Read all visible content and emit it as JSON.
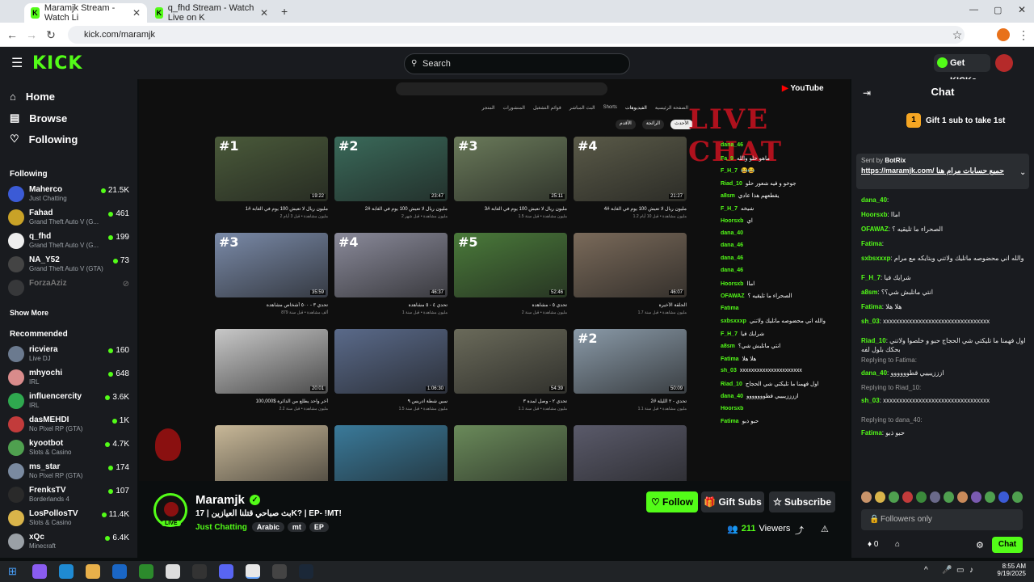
{
  "browser": {
    "tabs": [
      {
        "title": "Maramjk Stream - Watch Li",
        "active": true
      },
      {
        "title": "q_fhd Stream - Watch Live on K",
        "active": false
      }
    ],
    "url": "kick.com/maramjk"
  },
  "header": {
    "logo": "KICK",
    "search_placeholder": "Search",
    "get_kicks": "Get KICKs"
  },
  "sidebar": {
    "nav": [
      {
        "label": "Home",
        "icon": "home-icon"
      },
      {
        "label": "Browse",
        "icon": "browse-icon"
      },
      {
        "label": "Following",
        "icon": "heart-icon"
      }
    ],
    "following_title": "Following",
    "following": [
      {
        "name": "Maherco",
        "category": "Just Chatting",
        "viewers": "21.5K",
        "color": "#3b5bd6"
      },
      {
        "name": "Fahad",
        "category": "Grand Theft Auto V (G...",
        "viewers": "461",
        "color": "#c9a227"
      },
      {
        "name": "q_fhd",
        "category": "Grand Theft Auto V (G...",
        "viewers": "199",
        "color": "#eeeeee"
      },
      {
        "name": "NA_Y52",
        "category": "Grand Theft Auto V (GTA)",
        "viewers": "73",
        "color": "#444"
      },
      {
        "name": "ForzaAziz",
        "category": "",
        "viewers": "",
        "color": "#555",
        "offline": true
      }
    ],
    "show_more": "Show More",
    "recommended_title": "Recommended",
    "recommended": [
      {
        "name": "ricviera",
        "category": "Live DJ",
        "viewers": "160",
        "color": "#6b7a8f"
      },
      {
        "name": "mhyochi",
        "category": "IRL",
        "viewers": "648",
        "color": "#d98b8b"
      },
      {
        "name": "influencercity",
        "category": "IRL",
        "viewers": "3.6K",
        "color": "#2fa84f"
      },
      {
        "name": "dasMEHDI",
        "category": "No Pixel RP (GTA)",
        "viewers": "1K",
        "color": "#c23b3b"
      },
      {
        "name": "kyootbot",
        "category": "Slots & Casino",
        "viewers": "4.7K",
        "color": "#4fa04f"
      },
      {
        "name": "ms_star",
        "category": "No Pixel RP (GTA)",
        "viewers": "174",
        "color": "#7a8aa0"
      },
      {
        "name": "FrenksTV",
        "category": "Borderlands 4",
        "viewers": "107",
        "color": "#2a2a2a"
      },
      {
        "name": "LosPollosTV",
        "category": "Slots & Casino",
        "viewers": "11.4K",
        "color": "#d9b44a"
      },
      {
        "name": "xQc",
        "category": "Minecraft",
        "viewers": "6.4K",
        "color": "#9aa0a6"
      }
    ]
  },
  "youtube": {
    "logo": "YouTube",
    "tabs": [
      "الصفحة الرئيسية",
      "الفيديوهات",
      "Shorts",
      "البث المباشر",
      "قوائم التشغيل",
      "المنشورات",
      "المتجر"
    ],
    "filters": [
      "الأحدث",
      "الرائجة",
      "الأقدم"
    ],
    "videos": [
      {
        "num": "#1",
        "duration": "19:22",
        "title": "مليون ريال لا تعيش 100 يوم في الغابة #1",
        "meta": "2 مليون مشاهدة • قبل 3 أيام",
        "color": "#4a5a3a"
      },
      {
        "num": "#2",
        "duration": "23:47",
        "title": "مليون ريال لا تعيش 100 يوم في الغابة #2",
        "meta": "2 مليون مشاهدة • قبل شهر",
        "color": "#3a6a5a"
      },
      {
        "num": "#3",
        "duration": "25:11",
        "title": "مليون ريال لا تعيش 100 يوم في الغابة #3",
        "meta": "1.5 مليون مشاهدة • قبل سنة",
        "color": "#6a7a5a"
      },
      {
        "num": "#4",
        "duration": "21:27",
        "title": "مليون ريال لا تعيش 100 يوم في الغابة #4",
        "meta": "1.2 مليون مشاهدة • قبل 10 أيام",
        "color": "#5a5a48"
      },
      {
        "num": "#3",
        "duration": "35:59",
        "title": "تحدي ٣ - ٥٠٠ أشخاص مشاهدة",
        "meta": "879 ألف مشاهدة • قبل سنة",
        "color": "#7a8aa8"
      },
      {
        "num": "#4",
        "duration": "46:37",
        "title": "تحدي ٤ - ٥ مشاهدة",
        "meta": "1 مليون مشاهدة • قبل سنة",
        "color": "#8a8a9a"
      },
      {
        "num": "#5",
        "duration": "52:46",
        "title": "تحدي ٥ - مشاهدة",
        "meta": "2 مليون مشاهدة • قبل سنة",
        "color": "#4a7a3a"
      },
      {
        "num": "",
        "duration": "46:07",
        "title": "الحلقة الأخيرة",
        "meta": "1.7 مليون مشاهدة • قبل سنة",
        "color": "#7a6a5a"
      },
      {
        "num": "",
        "duration": "20:01",
        "title": "أخر واحد يطلع من الدائرة $100,000",
        "meta": "2.2 مليون مشاهدة • قبل سنة",
        "color": "#c8c8c8"
      },
      {
        "num": "",
        "duration": "1:06:30",
        "title": "سين شطة ادريس ٩",
        "meta": "1.5 مليون مشاهدة • قبل سنة",
        "color": "#5a6a8a"
      },
      {
        "num": "",
        "duration": "54:39",
        "title": "تحدي ٢ - وصل لمدة ٣",
        "meta": "1.1 مليون مشاهدة • قبل سنة",
        "color": "#6a6a5a"
      },
      {
        "num": "#2",
        "duration": "50:09",
        "title": "تحدي - ٢ الليلة #2",
        "meta": "1.1 مليون مشاهدة • قبل سنة",
        "color": "#8a9aa8"
      },
      {
        "num": "",
        "duration": "",
        "title": "",
        "meta": "",
        "color": "#c8b898"
      },
      {
        "num": "",
        "duration": "",
        "title": "",
        "meta": "",
        "color": "#3a7a9a"
      },
      {
        "num": "",
        "duration": "",
        "title": "",
        "meta": "",
        "color": "#6a8a5a"
      },
      {
        "num": "",
        "duration": "",
        "title": "",
        "meta": "",
        "color": "#5a5a6a"
      }
    ],
    "live_chat_title": "LIVE CHAT",
    "live_chat": [
      {
        "user": "dana_46",
        "msg": ""
      },
      {
        "user": "Fa_9",
        "msg": "ماهو حلو والله"
      },
      {
        "user": "F_H_7",
        "msg": "😂😂"
      },
      {
        "user": "Riad_10",
        "msg": "جوخو و فيه شعور حلو"
      },
      {
        "user": "a8sm",
        "msg": "يقطعهم هذا عادي"
      },
      {
        "user": "F_H_7",
        "msg": "شيخه"
      },
      {
        "user": "Hoorsxb",
        "msg": "اي"
      },
      {
        "user": "dana_40",
        "msg": ""
      },
      {
        "user": "dana_46",
        "msg": ""
      },
      {
        "user": "dana_46",
        "msg": ""
      },
      {
        "user": "dana_46",
        "msg": ""
      },
      {
        "user": "Hoorsxb",
        "msg": "اماا"
      },
      {
        "user": "OFAWAZ",
        "msg": "الصحراء ما تليقيه ؟"
      },
      {
        "user": "Fatima",
        "msg": ""
      },
      {
        "user": "sxbsxxxp",
        "msg": "والله اني محضوصه ماتليك ولاتني"
      },
      {
        "user": "F_H_7",
        "msg": "شرايك فيا"
      },
      {
        "user": "a8sm",
        "msg": "انتي ماتلبش شي؟"
      },
      {
        "user": "Fatima",
        "msg": "هلا هلا"
      },
      {
        "user": "sh_03",
        "msg": "xxxxxxxxxxxxxxxxxxxxxx"
      },
      {
        "user": "Riad_10",
        "msg": "اول فهمنا ما تليكتي شي الحجاج"
      },
      {
        "user": "dana_40",
        "msg": "اززززيبييي فطووووووو"
      },
      {
        "user": "Hoorsxb",
        "msg": ""
      },
      {
        "user": "Fatima",
        "msg": "حبو ذبو"
      }
    ]
  },
  "stream": {
    "name": "Maramjk",
    "title": "بث صباحي قتلنا العيازين | 17K? | EP- !MT!",
    "category": "Just Chatting",
    "tags": [
      "Arabic",
      "mt",
      "EP"
    ],
    "follow": "Follow",
    "gift": "Gift Subs",
    "subscribe": "Subscribe",
    "viewers": "211",
    "viewers_label": "Viewers",
    "live": "LIVE"
  },
  "chat": {
    "title": "Chat",
    "gift_banner": "Gift 1 sub to take 1st",
    "gift_rank": "1",
    "pinned_sent_by": "Sent by",
    "pinned_user": "BotRix",
    "pinned_msg": "https://maramjk.com/ جميع حسابات مرام هنا",
    "messages": [
      {
        "user": "dana_40",
        "msg": ""
      },
      {
        "user": "Hoorsxb",
        "msg": "اماا"
      },
      {
        "user": "OFAWAZ",
        "msg": "الصحراء ما تليقيه ؟"
      },
      {
        "user": "Fatima",
        "msg": ""
      },
      {
        "user": "sxbsxxxp",
        "msg": "والله اني محضوصه ماتليك ولاتني وبتايكه مع مرام"
      },
      {
        "user": "F_H_7",
        "msg": "شرايك فيا"
      },
      {
        "user": "a8sm",
        "msg": "انتي ماتلبش شي؟؟"
      },
      {
        "user": "Fatima",
        "msg": "هلا هلا"
      },
      {
        "user": "sh_03",
        "msg": "xxxxxxxxxxxxxxxxxxxxxxxxxxxxxxxxx"
      },
      {
        "user": "Riad_10",
        "msg": "اول فهمنا ما تليكتي شي الحجاج حبو و خلصوا ولاتني بحكك بلول لفه"
      },
      {
        "reply": "Replying to Fatima:"
      },
      {
        "user": "dana_40",
        "msg": "ازززيبييي قطوووووو"
      },
      {
        "reply": "Replying to Riad_10:"
      },
      {
        "user": "sh_03",
        "msg": "xxxxxxxxxxxxxxxxxxxxxxxxxxxxxxxxx"
      },
      {
        "reply": "Replying to dana_40:"
      },
      {
        "user": "Fatima",
        "msg": "حبو ذبو"
      }
    ],
    "followers_only": "Followers only",
    "kicks": "0",
    "send": "Chat"
  },
  "taskbar": {
    "time": "8:55 AM",
    "date": "9/19/2025"
  },
  "colors": {
    "accent": "#53fc18",
    "bg": "#0b0e0f",
    "panel": "#191b1f"
  }
}
